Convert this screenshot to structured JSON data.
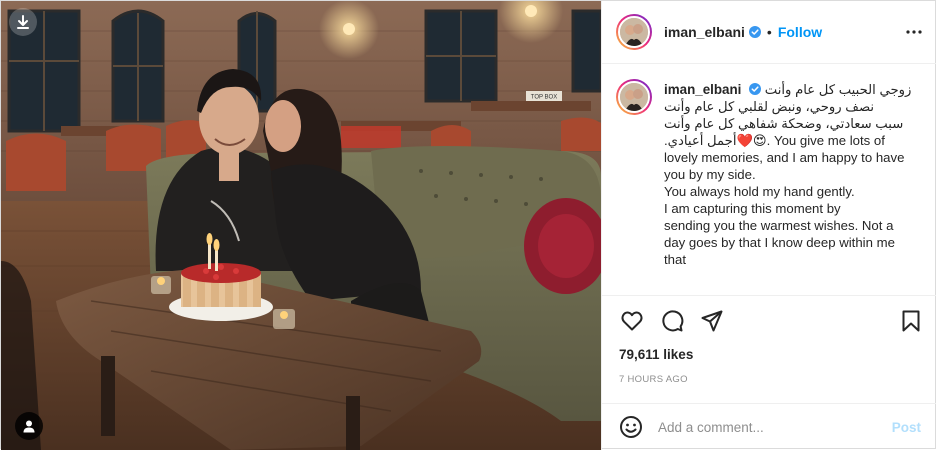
{
  "post": {
    "author": "iman_elbani",
    "follow_label": "Follow",
    "separator": "•",
    "caption": {
      "arabic_lines": [
        "زوجي الحبيب كل عام وأنت",
        "نصف روحي، ونبض لقلبي كل عام وأنت",
        "سبب سعادتي، وضحكة شفاهي كل عام وأنت",
        "أجمل أعيادي."
      ],
      "emojis": "❤️😍",
      "english_lines": [
        ". You give me lots of",
        "lovely memories, and I am happy to have",
        "you by my side.",
        "You always hold my hand gently.",
        "I am capturing this moment by",
        "sending you the warmest wishes. Not a",
        "day goes by that I know deep within me",
        "that"
      ]
    },
    "likes": "79,611 likes",
    "time": "7 HOURS AGO"
  },
  "photo": {
    "sign_text": "TOP BOX"
  },
  "comment": {
    "placeholder": "Add a comment...",
    "post_label": "Post"
  },
  "icons": {
    "header": [
      "verified-badge-icon",
      "more-options-icon"
    ],
    "actions": [
      "heart-icon",
      "comment-icon",
      "share-icon",
      "bookmark-icon"
    ],
    "overlay": [
      "download-icon",
      "user-tag-icon"
    ],
    "comment": [
      "emoji-icon"
    ]
  },
  "colors": {
    "accent": "#0095f6",
    "post_disabled": "#b2dffc",
    "muted": "#8e8e8e",
    "text": "#262626"
  }
}
